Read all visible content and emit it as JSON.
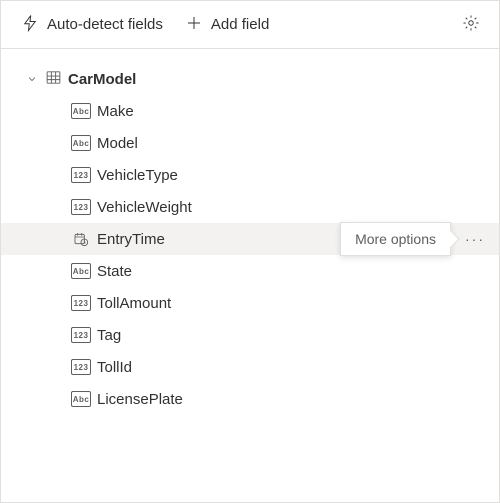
{
  "toolbar": {
    "autoDetect": "Auto-detect fields",
    "addField": "Add field"
  },
  "tree": {
    "rootName": "CarModel",
    "fields": [
      {
        "name": "Make",
        "type": "Abc",
        "selected": false
      },
      {
        "name": "Model",
        "type": "Abc",
        "selected": false
      },
      {
        "name": "VehicleType",
        "type": "123",
        "selected": false
      },
      {
        "name": "VehicleWeight",
        "type": "123",
        "selected": false
      },
      {
        "name": "EntryTime",
        "type": "datetime",
        "selected": true
      },
      {
        "name": "State",
        "type": "Abc",
        "selected": false
      },
      {
        "name": "TollAmount",
        "type": "123",
        "selected": false
      },
      {
        "name": "Tag",
        "type": "123",
        "selected": false
      },
      {
        "name": "TollId",
        "type": "123",
        "selected": false
      },
      {
        "name": "LicensePlate",
        "type": "Abc",
        "selected": false
      }
    ]
  },
  "tooltip": {
    "moreOptions": "More options"
  }
}
